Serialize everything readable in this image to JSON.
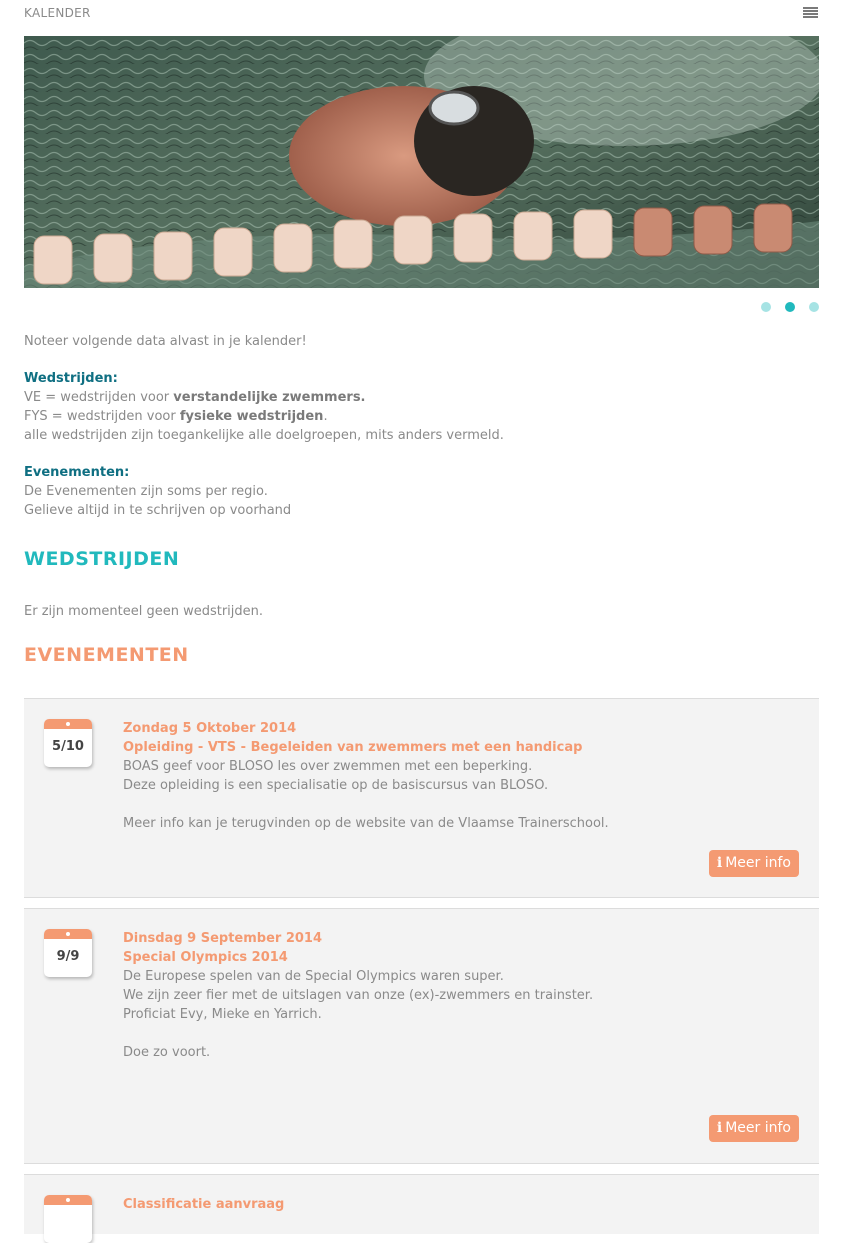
{
  "header": {
    "title": "KALENDER",
    "menu_icon": "list-icon"
  },
  "slider": {
    "dots": 3,
    "active_index": 1
  },
  "intro": {
    "line1": "Noteer volgende data alvast in je kalender!",
    "wedstrijden_heading": "Wedstrijden:",
    "ve_prefix": "VE = wedstrijden voor ",
    "ve_bold": "verstandelijke zwemmers.",
    "fys_prefix": "FYS = wedstrijden voor ",
    "fys_bold": "fysieke wedstrijden",
    "fys_suffix": ".",
    "all_line": "alle wedstrijden zijn toegankelijke alle doelgroepen, mits anders vermeld.",
    "evenementen_heading": "Evenementen:",
    "ev_line1": "De Evenementen zijn soms per regio.",
    "ev_line2": "Gelieve altijd in te schrijven op voorhand"
  },
  "wedstrijden": {
    "heading": "WEDSTRIJDEN",
    "empty": "Er zijn momenteel geen wedstrijden."
  },
  "evenementen": {
    "heading": "EVENEMENTEN",
    "items": [
      {
        "cal": "5/10",
        "date": "Zondag 5 Oktober 2014",
        "title": "Opleiding - VTS - Begeleiden van zwemmers met een handicap",
        "d1": "BOAS geef voor BLOSO les over zwemmen met een beperking.",
        "d2": "Deze opleiding is een specialisatie op de basiscursus van BLOSO.",
        "d3": "Meer info kan je terugvinden op de website van de Vlaamse Trainerschool.",
        "button": "Meer info"
      },
      {
        "cal": "9/9",
        "date": "Dinsdag 9 September 2014",
        "title": "Special Olympics 2014",
        "d1": "De Europese spelen van de Special Olympics waren super.",
        "d2": "We zijn zeer fier met de uitslagen van onze (ex)-zwemmers en trainster.",
        "d3": "Proficiat Evy, Mieke en Yarrich.",
        "d4": "Doe zo voort.",
        "button": "Meer info"
      },
      {
        "title": "Classificatie aanvraag"
      }
    ]
  },
  "colors": {
    "teal": "#21b9bd",
    "dark_teal": "#0f6f82",
    "orange": "#f49a72"
  }
}
